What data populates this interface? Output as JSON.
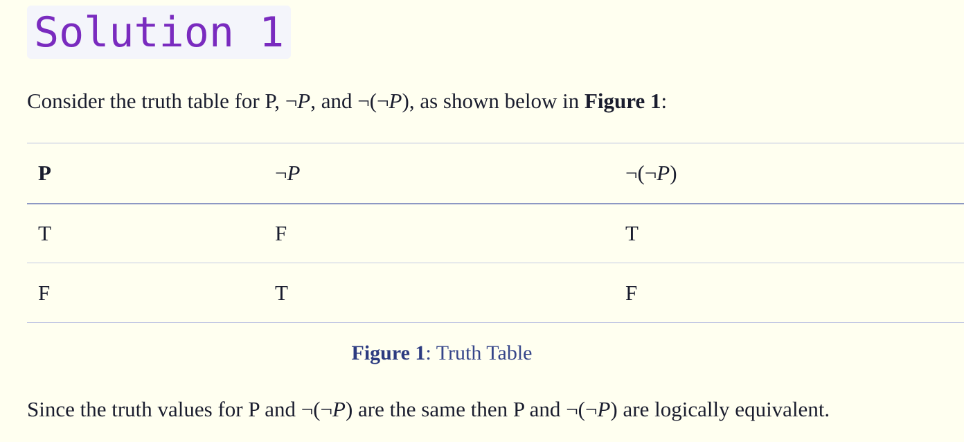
{
  "heading": "Solution 1",
  "intro": {
    "t1": "Consider the truth table for P, ",
    "m1_neg": "¬",
    "m1_var": "P",
    "t2": ", and ",
    "m2": "¬(¬",
    "m2_var": "P",
    "m2_close": ")",
    "t3": ", as shown below in ",
    "fig_ref": "Figure 1",
    "t4": ":"
  },
  "table": {
    "headers": {
      "p": "P",
      "not_p_neg": "¬",
      "not_p_var": "P",
      "dn_pre": "¬(¬",
      "dn_var": "P",
      "dn_close": ")"
    },
    "rows": [
      [
        "T",
        "F",
        "T"
      ],
      [
        "F",
        "T",
        "F"
      ]
    ]
  },
  "caption": {
    "label": "Figure 1",
    "text": ": Truth Table"
  },
  "conclusion": {
    "t1": "Since the truth values for P and ",
    "m1": "¬(¬",
    "m1_var": "P",
    "m1_close": ")",
    "t2": " are the same then P and ",
    "m2": "¬(¬",
    "m2_var": "P",
    "m2_close": ")",
    "t3": " are logically equivalent."
  }
}
